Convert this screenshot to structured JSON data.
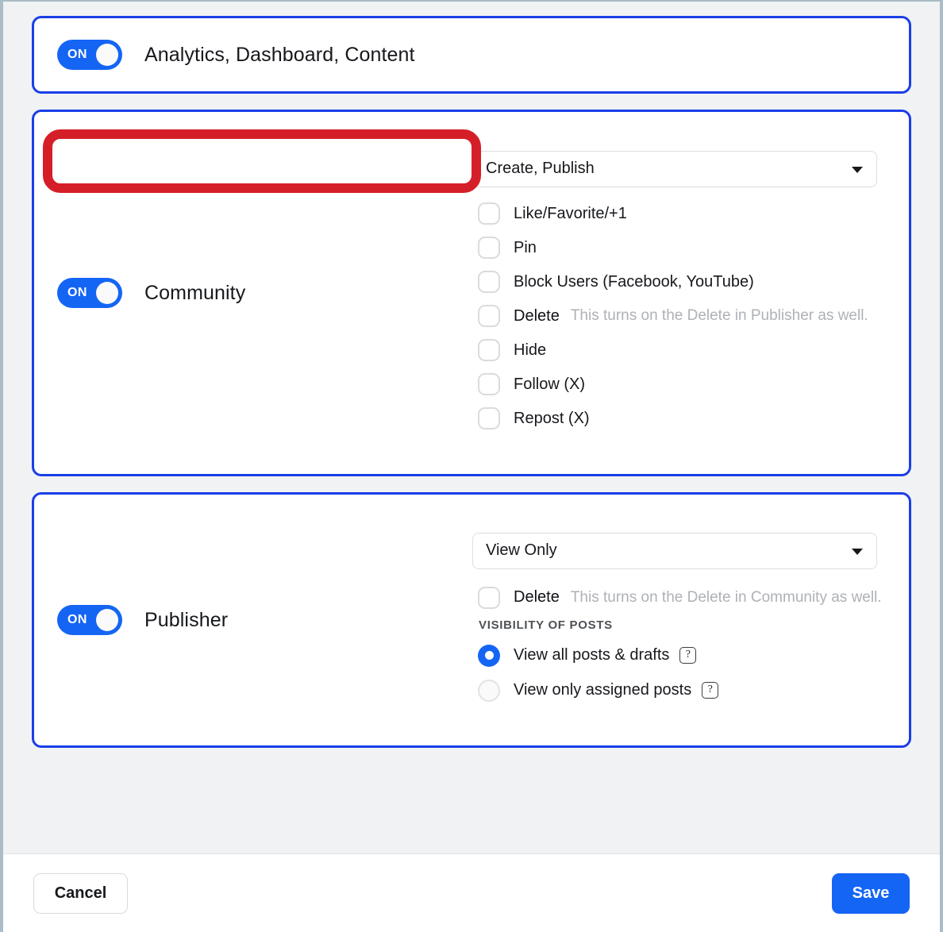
{
  "colors": {
    "accent": "#1565f5",
    "card_border": "#1a3ee8",
    "highlight": "#d51f28",
    "page_bg": "#f1f2f3",
    "hint_text": "#aeb1b6"
  },
  "cards": [
    {
      "id": "analytics",
      "toggle": {
        "state_label": "ON",
        "on": true
      },
      "title": "Analytics, Dashboard, Content"
    },
    {
      "id": "community",
      "toggle": {
        "state_label": "ON",
        "on": true
      },
      "title": "Community",
      "select": {
        "value": "Create, Publish",
        "highlighted": true,
        "caret": "chevron-down-icon"
      },
      "options": [
        {
          "label": "Like/Favorite/+1",
          "checked": false,
          "hint": ""
        },
        {
          "label": "Pin",
          "checked": false,
          "hint": ""
        },
        {
          "label": "Block Users (Facebook, YouTube)",
          "checked": false,
          "hint": ""
        },
        {
          "label": "Delete",
          "checked": false,
          "hint": "This turns on the Delete in Publisher as well.",
          "strong": true
        },
        {
          "label": "Hide",
          "checked": false,
          "hint": ""
        },
        {
          "label": "Follow (X)",
          "checked": false,
          "hint": ""
        },
        {
          "label": "Repost (X)",
          "checked": false,
          "hint": ""
        }
      ]
    },
    {
      "id": "publisher",
      "toggle": {
        "state_label": "ON",
        "on": true
      },
      "title": "Publisher",
      "select": {
        "value": "View Only",
        "highlighted": false,
        "caret": "chevron-down-icon"
      },
      "delete_option": {
        "label": "Delete",
        "checked": false,
        "hint": "This turns on the Delete in Community as well."
      },
      "visibility": {
        "section_label": "VISIBILITY OF POSTS",
        "radios": [
          {
            "label": "View all posts & drafts",
            "selected": true,
            "help": "?"
          },
          {
            "label": "View only assigned posts",
            "selected": false,
            "help": "?"
          }
        ]
      }
    }
  ],
  "footer": {
    "cancel_label": "Cancel",
    "save_label": "Save"
  }
}
